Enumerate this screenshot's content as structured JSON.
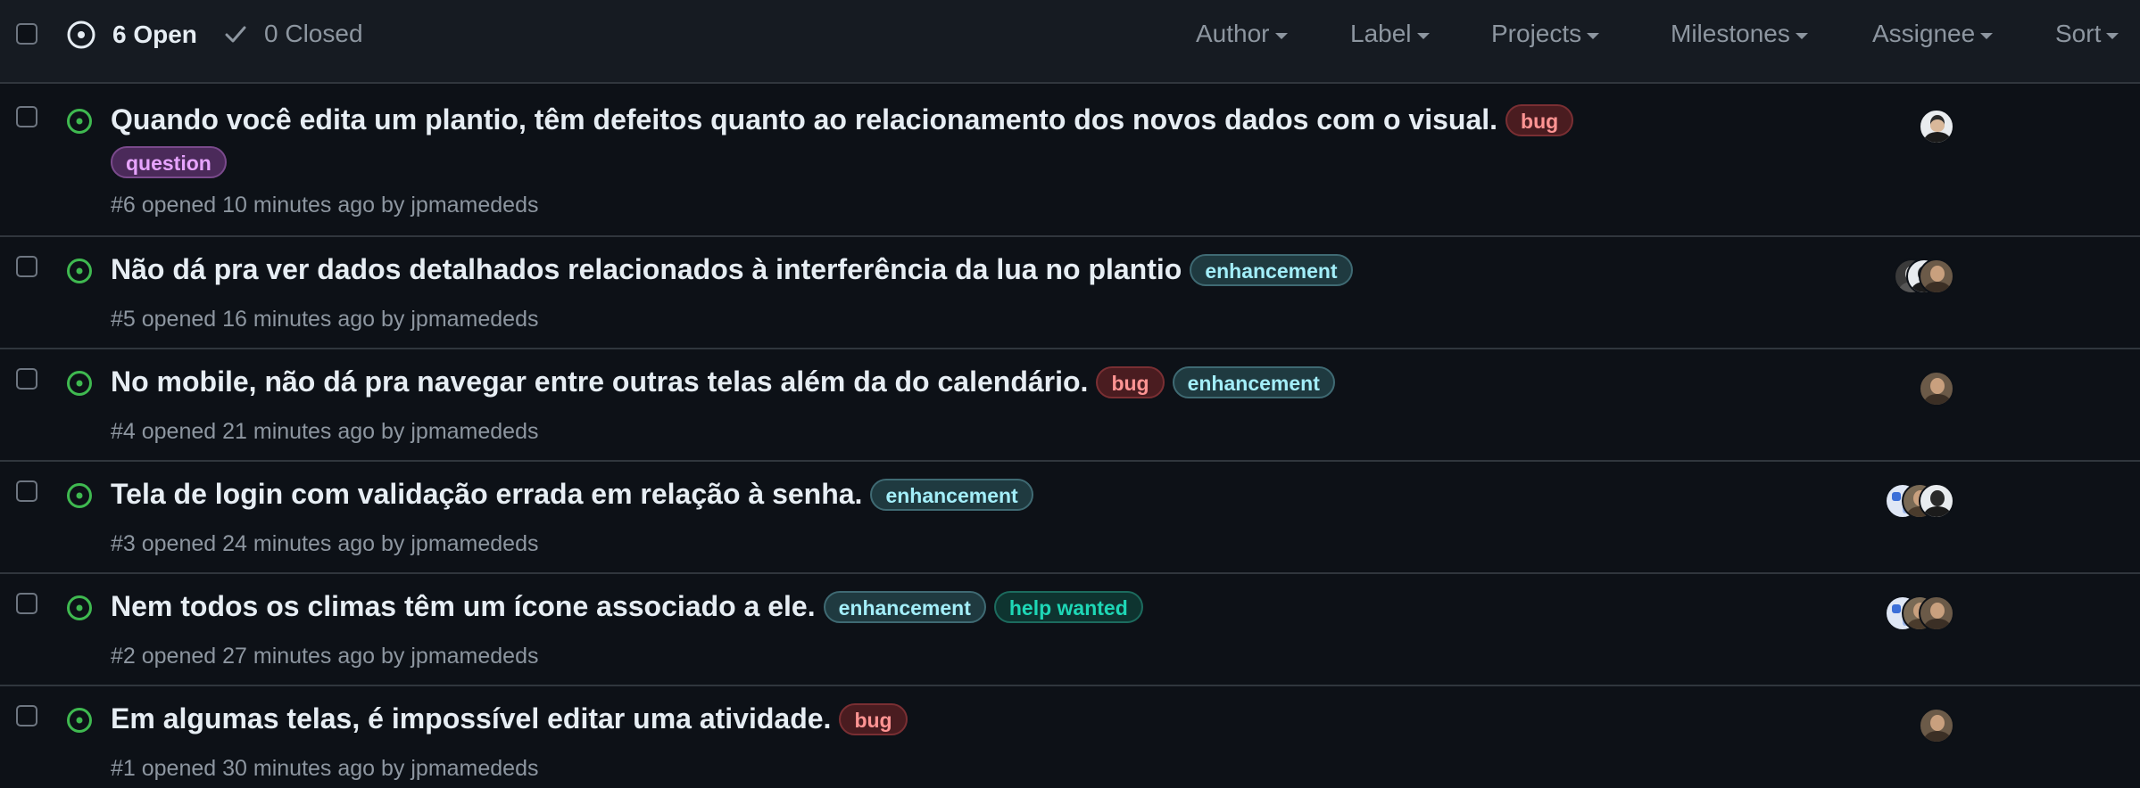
{
  "header": {
    "open_count": "6 Open",
    "closed_count": "0 Closed",
    "filters": {
      "author": "Author",
      "label": "Label",
      "projects": "Projects",
      "milestones": "Milestones",
      "assignee": "Assignee",
      "sort": "Sort"
    }
  },
  "issues": [
    {
      "title": "Quando você edita um plantio, têm defeitos quanto ao relacionamento dos novos dados com o visual.",
      "labels": [
        "bug",
        "question"
      ],
      "meta": "#6 opened 10 minutes ago by jpmamededs"
    },
    {
      "title": "Não dá pra ver dados detalhados relacionados à interferência da lua no plantio",
      "labels": [
        "enhancement"
      ],
      "meta": "#5 opened 16 minutes ago by jpmamededs"
    },
    {
      "title": "No mobile, não dá pra navegar entre outras telas além da do calendário.",
      "labels": [
        "bug",
        "enhancement"
      ],
      "meta": "#4 opened 21 minutes ago by jpmamededs"
    },
    {
      "title": "Tela de login com validação errada em relação à senha.",
      "labels": [
        "enhancement"
      ],
      "meta": "#3 opened 24 minutes ago by jpmamededs"
    },
    {
      "title": "Nem todos os climas têm um ícone associado a ele.",
      "labels": [
        "enhancement",
        "help wanted"
      ],
      "meta": "#2 opened 27 minutes ago by jpmamededs"
    },
    {
      "title": "Em algumas telas, é impossível editar uma atividade.",
      "labels": [
        "bug"
      ],
      "meta": "#1 opened 30 minutes ago by jpmamededs"
    }
  ],
  "colors": {
    "open_green": "#3fb950",
    "background": "#0d1117",
    "header_background": "#161b22"
  },
  "icons": {
    "open_state": "issue-opened-icon",
    "closed_state": "check-icon",
    "row_state": "issue-opened-icon",
    "dropdown": "caret-down-icon"
  }
}
